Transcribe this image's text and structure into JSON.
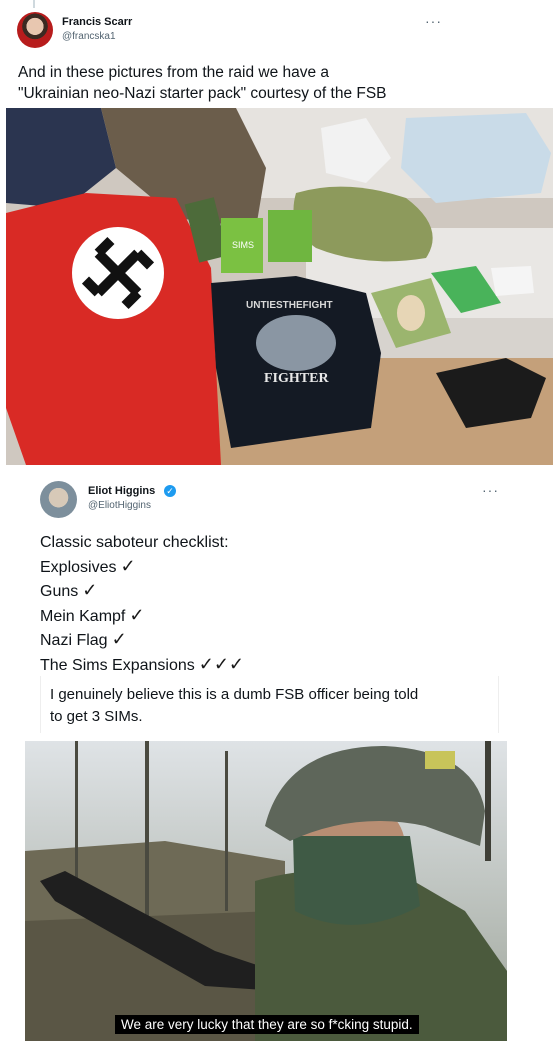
{
  "tweet1": {
    "author_name": "Francis Scarr",
    "author_handle": "@francska1",
    "more_label": "···",
    "text_line1": "And in these pictures from the raid we have a",
    "text_line2": "\"Ukrainian neo-Nazi starter pack\" courtesy of the FSB",
    "photo_labels": {
      "sims_box": "SIMS",
      "shirt_top": "UNTIESTHEFIGHT",
      "shirt_bottom": "FIGHTER",
      "book_cover": "Mein Kampf"
    }
  },
  "tweet2": {
    "author_name": "Eliot Higgins",
    "author_handle": "@EliotHiggins",
    "verified_icon": "verified-badge-icon",
    "more_label": "···",
    "checklist_title": "Classic saboteur checklist:",
    "items": [
      {
        "label": "Explosives",
        "checks": "✓"
      },
      {
        "label": "Guns",
        "checks": "✓"
      },
      {
        "label": "Mein Kampf",
        "checks": "✓"
      },
      {
        "label": "Nazi Flag",
        "checks": "✓"
      },
      {
        "label": "The Sims Expansions",
        "checks": "✓✓✓"
      }
    ],
    "quote_line1": "I genuinely believe this is a dumb FSB officer being told",
    "quote_line2": "to get 3 SIMs.",
    "video_subtitle": "We are very lucky that they are so f*cking stupid."
  },
  "colors": {
    "accent": "#1d9bf0",
    "text": "#0f1419",
    "muted": "#536471"
  }
}
